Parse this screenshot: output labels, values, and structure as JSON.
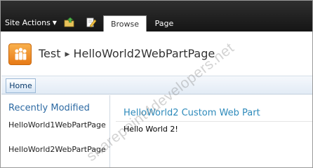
{
  "ribbon": {
    "site_actions_label": "Site Actions",
    "tabs": [
      {
        "label": "Browse",
        "selected": true
      },
      {
        "label": "Page",
        "selected": false
      }
    ],
    "icons": [
      "navigate-up-icon",
      "edit-page-icon"
    ]
  },
  "title_area": {
    "site_title": "Test",
    "page_title": "HelloWorld2WebPartPage"
  },
  "top_nav": {
    "items": [
      "Home"
    ]
  },
  "quick_launch": {
    "heading": "Recently Modified",
    "items": [
      "HelloWorld1WebPartPage",
      "HelloWorld2WebPartPage"
    ]
  },
  "web_part": {
    "title": "HelloWorld2 Custom Web Part",
    "body": "Hello World 2!"
  },
  "watermark": "sharepoint4developers.net",
  "colors": {
    "ribbon_bg": "#1f1f1f",
    "link_blue": "#2d6aa3",
    "webpart_title": "#2d8abb",
    "logo_orange": "#f08a1e"
  }
}
